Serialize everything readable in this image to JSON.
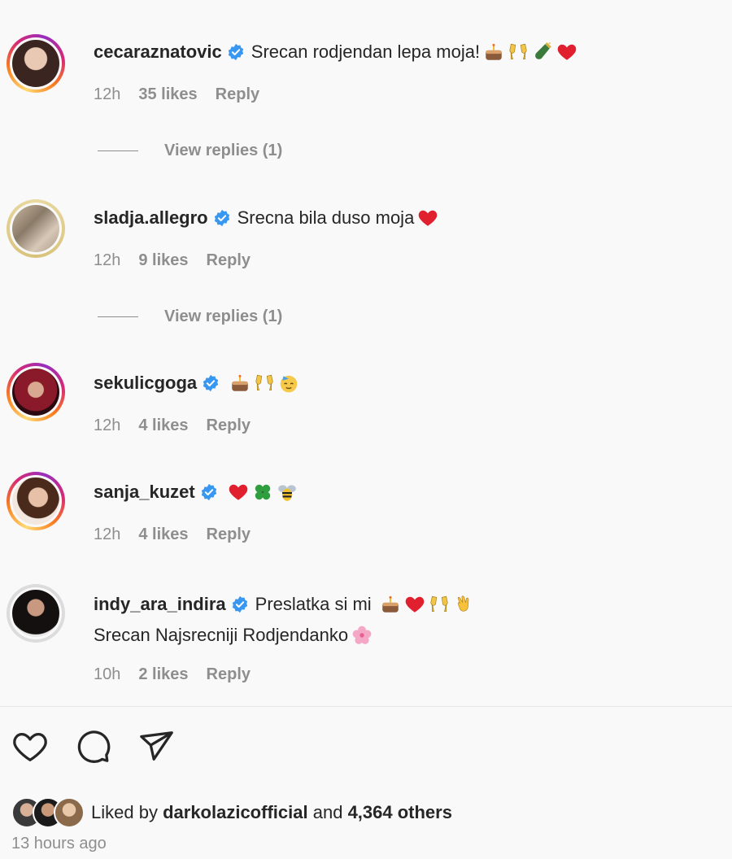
{
  "comments": [
    {
      "username": "cecaraznatovic",
      "text": "Srecan rodjendan lepa moja!",
      "emojis": [
        "cake-icon",
        "clinking-glasses-icon",
        "champagne-icon",
        "heart-icon"
      ],
      "time": "12h",
      "likes": "35 likes",
      "reply": "Reply",
      "view_replies": "View replies (1)"
    },
    {
      "username": "sladja.allegro",
      "text": "Srecna bila duso moja",
      "emojis": [
        "heart-icon"
      ],
      "time": "12h",
      "likes": "9 likes",
      "reply": "Reply",
      "view_replies": "View replies (1)"
    },
    {
      "username": "sekulicgoga",
      "text": "",
      "emojis": [
        "cake-icon",
        "clinking-glasses-icon",
        "partying-face-icon"
      ],
      "time": "12h",
      "likes": "4 likes",
      "reply": "Reply"
    },
    {
      "username": "sanja_kuzet",
      "text": "",
      "emojis": [
        "heart-icon",
        "four-leaf-clover-icon",
        "bee-icon"
      ],
      "time": "12h",
      "likes": "4 likes",
      "reply": "Reply"
    },
    {
      "username": "indy_ara_indira",
      "text": "Preslatka si mi",
      "text2": "Srecan Najsrecniji Rodjendanko",
      "emojis": [
        "cake-icon",
        "heart-icon",
        "clinking-glasses-icon",
        "clapping-hands-icon"
      ],
      "emojis2": [
        "cherry-blossom-icon"
      ],
      "time": "10h",
      "likes": "2 likes",
      "reply": "Reply"
    }
  ],
  "likes": {
    "prefix": "Liked by",
    "user": "darkolazicofficial",
    "and": "and",
    "others": "4,364 others"
  },
  "posted": "13 hours ago",
  "icons": {
    "like": "heart-outline-icon",
    "comment": "comment-bubble-icon",
    "share": "paper-plane-icon",
    "verified": "verified-badge-icon"
  },
  "colors": {
    "verified": "#3897f0",
    "muted": "#8e8e8e",
    "heart": "#e0202f"
  }
}
